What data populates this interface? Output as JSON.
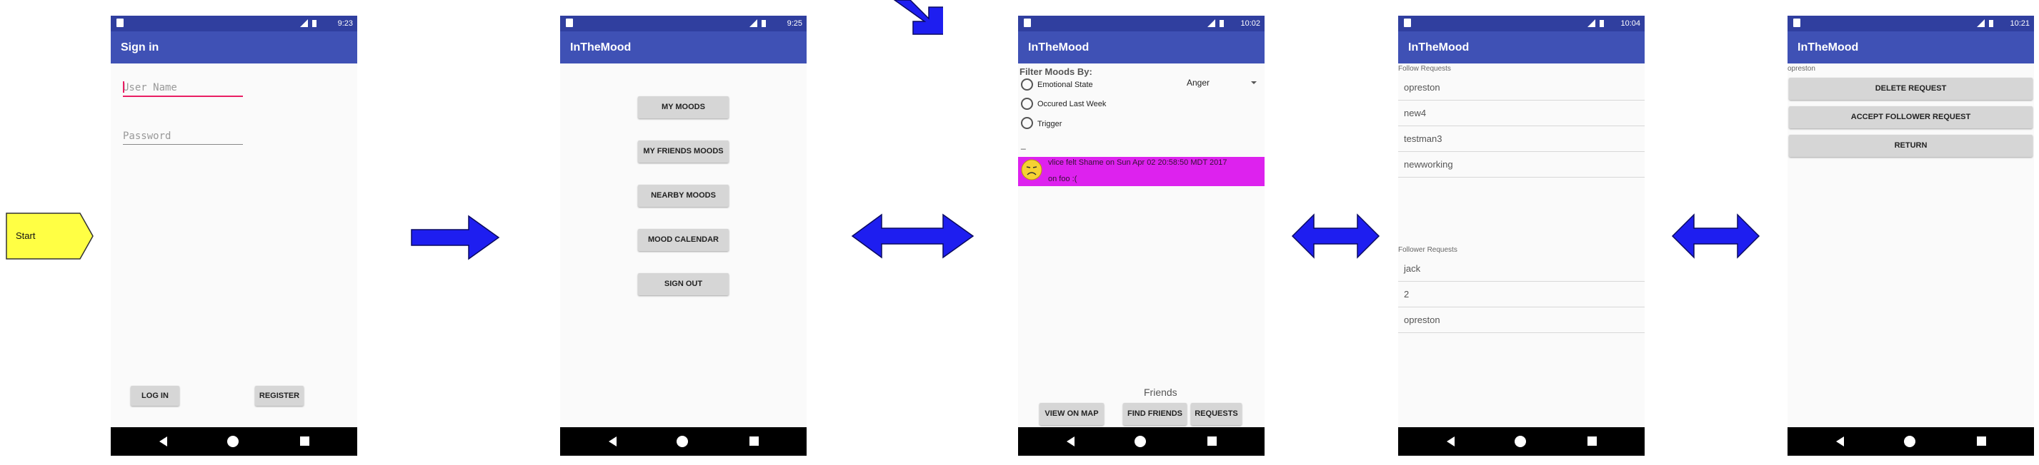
{
  "start_label": "Start",
  "colors": {
    "arrow": "#1e1ef0",
    "start_fill": "#ffff44",
    "appbar": "#3f51b5",
    "statusbar": "#303f9f",
    "mood_item": "#dd22ee"
  },
  "screens": {
    "signin": {
      "time": "9:23",
      "title": "Sign in",
      "username_placeholder": "User Name",
      "password_placeholder": "Password",
      "login": "LOG IN",
      "register": "REGISTER"
    },
    "menu": {
      "time": "9:25",
      "title": "InTheMood",
      "buttons": [
        "MY MOODS",
        "MY FRIENDS MOODS",
        "NEARBY MOODS",
        "MOOD CALENDAR",
        "SIGN OUT"
      ]
    },
    "moods": {
      "time": "10:02",
      "title": "InTheMood",
      "filter_header": "Filter Moods By:",
      "filters": [
        "Emotional State",
        "Occured Last Week",
        "Trigger"
      ],
      "dropdown_value": "Anger",
      "dash": "_",
      "mood_item_line1": "vlice felt Shame on Sun Apr 02 20:58:50 MDT 2017",
      "mood_item_line2": "on foo :(",
      "friends_label": "Friends",
      "buttons": [
        "VIEW ON MAP",
        "FIND FRIENDS",
        "REQUESTS"
      ]
    },
    "requests": {
      "time": "10:04",
      "title": "InTheMood",
      "follow_header": "Follow Requests",
      "follow_items": [
        "opreston",
        "new4",
        "testman3",
        "newworking"
      ],
      "follower_header": "Follower Requests",
      "follower_items": [
        "jack",
        "2",
        "opreston"
      ]
    },
    "request_detail": {
      "time": "10:21",
      "title": "InTheMood",
      "user": "opreston",
      "buttons": [
        "DELETE REQUEST",
        "ACCEPT FOLLOWER REQUEST",
        "RETURN"
      ]
    }
  }
}
